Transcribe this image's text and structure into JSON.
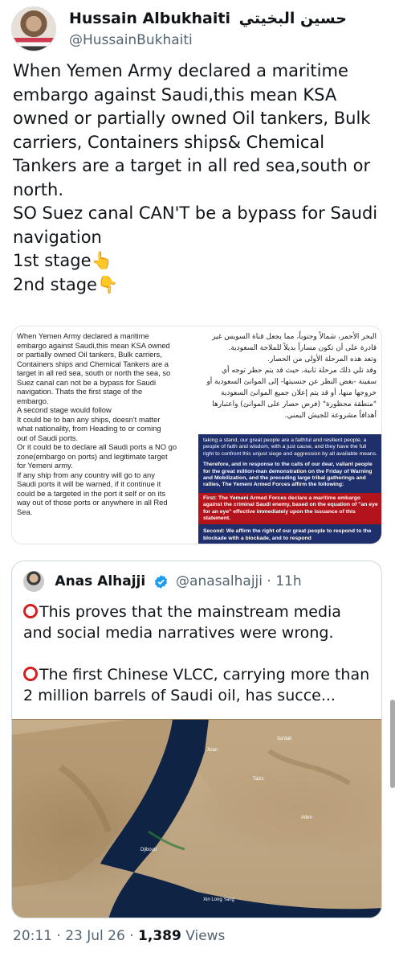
{
  "author": {
    "name": "Hussain Albukhaiti",
    "name_arabic": "حسين البخيتي",
    "handle": "@HussainBukhaiti"
  },
  "tweet": {
    "text": "When Yemen Army declared a maritime embargo against Saudi,this mean KSA owned or partially owned Oil tankers, Bulk carriers, Containers ships& Chemical Tankers are a target in all red sea,south or north.\nSO Suez canal CAN'T be a bypass for Saudi navigation\n1st stage👆\n2nd stage👇"
  },
  "document_image": {
    "english_text": "When Yemen Army declared a maritime\nembargo against Saudi,this mean KSA owned\nor partially owned Oil tankers, Bulk carriers,\nContainers ships and Chemical Tankers are a\ntarget in all red sea, south or north the sea, so\nSuez canal can not be a bypass for Saudi\nnavigation. Thats the first stage of the\nembargo.\nA second stage would follow\nIt could be to ban any ships, doesn't matter\nwhat nationality, from Heading to or coming\nout of Saudi ports.\nOr it could be to declare all Saudi ports a NO go\nzone(embargo on ports) and legitimate target\nfor Yemeni army.\nIf any ship from any country will go to any\nSaudi ports it will be warned, if it continue it\ncould be a targeted in the port it self or on its\nway out of those ports or anywhere in all Red\nSea.",
    "arabic_text": "البحر الأحمر، شمالاً وجنوباً، مما يجعل قناة السويس غير قادرة على أن تكون مساراً بديلاً للملاحة السعودية.\nوتعد هذه المرحلة الأولى من الحصار.\nوقد تلي ذلك مرحلة ثانية، حيث قد يتم حظر توجه أي سفينة -بغض النظر عن جنسيتها- إلى الموانئ السعودية أو خروجها منها، أو قد يتم إعلان جميع الموانئ السعودية \"منطقة محظورة\" (فرض حصار على الموانئ) واعتبارها أهدافاً مشروعة للجيش اليمني.",
    "statement_intro": "taking a stand, our great people are a faithful and resilient people, a people of faith and wisdom, with a just cause, and they have the full right to confront this unjust siege and aggression by all available means.",
    "statement_therefore": "Therefore, and in response to the calls of our dear, valiant people for the great million-man demonstration on the Friday of Warning and Mobilization, and the preceding large tribal gatherings and rallies, The Yemeni Armed Forces affirm the following:",
    "statement_first": "First: The Yemeni Armed Forces declare a maritime embargo against the criminal Saudi enemy, based on the equation of \"an eye for an eye\" effective immediately upon the issuance of this statement.",
    "statement_second": "Second: We affirm the right of our great people to respond to the blockade with a blockade, and to respond"
  },
  "quoted_tweet": {
    "name": "Anas Alhajji",
    "handle": "@anasalhajji",
    "separator": "·",
    "time": "11h",
    "paragraph1": "This proves that the mainstream media and social media narratives were wrong.",
    "paragraph2": "The first Chinese VLCC, carrying more than 2 million barrels of Saudi oil, has succe...",
    "map_labels": [
      "Djibouti",
      "Jizan",
      "Sa'dah",
      "Taizz",
      "Aden",
      "Xin Long Yang"
    ]
  },
  "meta": {
    "time": "20:11",
    "separator1": "·",
    "date": "23 Jul 26",
    "separator2": "·",
    "views": "1,389",
    "views_label": "Views"
  }
}
